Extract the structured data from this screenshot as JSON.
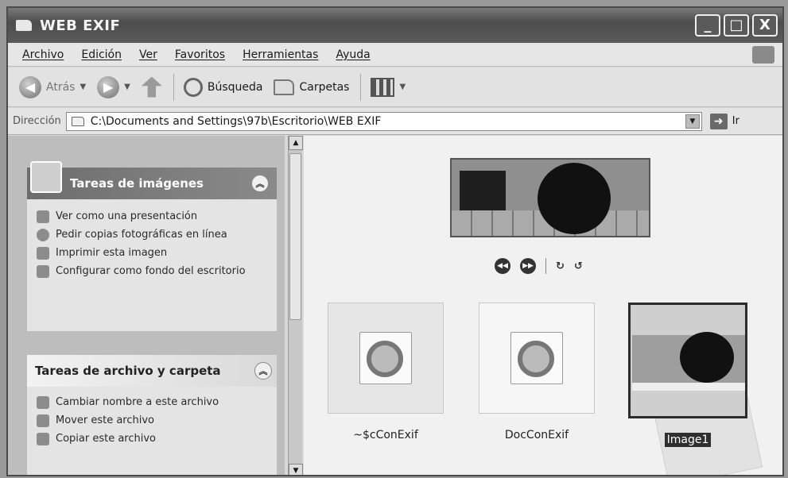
{
  "window": {
    "title": "WEB EXIF",
    "minimize": "_",
    "maximize": "□",
    "close": "X"
  },
  "menu": [
    "Archivo",
    "Edición",
    "Ver",
    "Favoritos",
    "Herramientas",
    "Ayuda"
  ],
  "toolbar": {
    "back": "Atrás",
    "search": "Búsqueda",
    "folders": "Carpetas"
  },
  "address": {
    "label": "Dirección",
    "path": "C:\\Documents and Settings\\97b\\Escritorio\\WEB EXIF",
    "go": "Ir"
  },
  "image_tasks": {
    "title": "Tareas de imágenes",
    "items": [
      "Ver como una presentación",
      "Pedir copias fotográficas en línea",
      "Imprimir esta imagen",
      "Configurar como fondo del escritorio"
    ]
  },
  "file_tasks": {
    "title": "Tareas de archivo y carpeta",
    "items": [
      "Cambiar nombre a este archivo",
      "Mover este archivo",
      "Copiar este archivo"
    ]
  },
  "files": [
    {
      "name": "~$cConExif",
      "selected": false
    },
    {
      "name": "DocConExif",
      "selected": false
    },
    {
      "name": "Image1",
      "selected": true
    }
  ]
}
